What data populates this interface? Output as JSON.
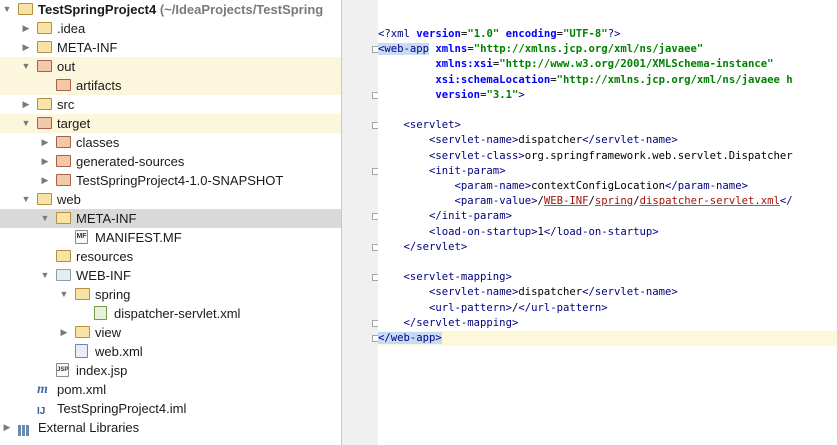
{
  "project_tree": [
    {
      "label": "TestSpringProject4",
      "suffix": "(~/IdeaProjects/TestSpring",
      "depth": 0,
      "expanded": true,
      "icon": "folder",
      "bold": true,
      "highlight": "none"
    },
    {
      "label": ".idea",
      "depth": 1,
      "expanded": false,
      "icon": "folder",
      "highlight": "none"
    },
    {
      "label": "META-INF",
      "depth": 1,
      "expanded": false,
      "icon": "folder",
      "highlight": "none"
    },
    {
      "label": "out",
      "depth": 1,
      "expanded": true,
      "icon": "folder-red",
      "highlight": "yellow"
    },
    {
      "label": "artifacts",
      "depth": 2,
      "expanded": null,
      "icon": "folder-red",
      "highlight": "yellow"
    },
    {
      "label": "src",
      "depth": 1,
      "expanded": false,
      "icon": "folder",
      "highlight": "none"
    },
    {
      "label": "target",
      "depth": 1,
      "expanded": true,
      "icon": "folder-red",
      "highlight": "yellow"
    },
    {
      "label": "classes",
      "depth": 2,
      "expanded": false,
      "icon": "folder-red",
      "highlight": "none"
    },
    {
      "label": "generated-sources",
      "depth": 2,
      "expanded": false,
      "icon": "folder-red",
      "highlight": "none"
    },
    {
      "label": "TestSpringProject4-1.0-SNAPSHOT",
      "depth": 2,
      "expanded": false,
      "icon": "folder-red",
      "highlight": "none"
    },
    {
      "label": "web",
      "depth": 1,
      "expanded": true,
      "icon": "folder",
      "highlight": "none"
    },
    {
      "label": "META-INF",
      "depth": 2,
      "expanded": true,
      "icon": "folder",
      "highlight": "gray"
    },
    {
      "label": "MANIFEST.MF",
      "depth": 3,
      "expanded": null,
      "icon": "file-mf",
      "highlight": "none"
    },
    {
      "label": "resources",
      "depth": 2,
      "expanded": null,
      "icon": "folder",
      "highlight": "none"
    },
    {
      "label": "WEB-INF",
      "depth": 2,
      "expanded": true,
      "icon": "folder-web",
      "highlight": "none"
    },
    {
      "label": "spring",
      "depth": 3,
      "expanded": true,
      "icon": "folder",
      "highlight": "none"
    },
    {
      "label": "dispatcher-servlet.xml",
      "depth": 4,
      "expanded": null,
      "icon": "file-spring-xml",
      "highlight": "none"
    },
    {
      "label": "view",
      "depth": 3,
      "expanded": false,
      "icon": "folder",
      "highlight": "none"
    },
    {
      "label": "web.xml",
      "depth": 3,
      "expanded": null,
      "icon": "file-web-xml",
      "highlight": "none"
    },
    {
      "label": "index.jsp",
      "depth": 2,
      "expanded": null,
      "icon": "file-jsp",
      "highlight": "none"
    },
    {
      "label": "pom.xml",
      "depth": 1,
      "expanded": null,
      "icon": "file-maven",
      "highlight": "none"
    },
    {
      "label": "TestSpringProject4.iml",
      "depth": 1,
      "expanded": null,
      "icon": "file-iml",
      "highlight": "none"
    },
    {
      "label": "External Libraries",
      "depth": 0,
      "expanded": false,
      "icon": "libraries",
      "highlight": "none"
    }
  ],
  "badges": {
    "mf": "MF",
    "jsp": "JSP",
    "iml": "IJ",
    "maven": "m"
  },
  "code_lines": [
    [
      {
        "t": "decl",
        "s": "<?xml "
      },
      {
        "t": "attr",
        "s": "version"
      },
      {
        "t": "txt",
        "s": "="
      },
      {
        "t": "val",
        "s": "\"1.0\""
      },
      {
        "t": "txt",
        "s": " "
      },
      {
        "t": "attr",
        "s": "encoding"
      },
      {
        "t": "txt",
        "s": "="
      },
      {
        "t": "val",
        "s": "\"UTF-8\""
      },
      {
        "t": "decl",
        "s": "?>"
      }
    ],
    [
      {
        "t": "sel",
        "s": "<web-app"
      },
      {
        "t": "txt",
        "s": " "
      },
      {
        "t": "attr",
        "s": "xmlns"
      },
      {
        "t": "txt",
        "s": "="
      },
      {
        "t": "val",
        "s": "\"http://xmlns.jcp.org/xml/ns/javaee\""
      }
    ],
    [
      {
        "t": "txt",
        "s": "         "
      },
      {
        "t": "attr",
        "s": "xmlns:xsi"
      },
      {
        "t": "txt",
        "s": "="
      },
      {
        "t": "val",
        "s": "\"http://www.w3.org/2001/XMLSchema-instance\""
      }
    ],
    [
      {
        "t": "txt",
        "s": "         "
      },
      {
        "t": "attr",
        "s": "xsi:schemaLocation"
      },
      {
        "t": "txt",
        "s": "="
      },
      {
        "t": "val",
        "s": "\"http://xmlns.jcp.org/xml/ns/javaee h"
      }
    ],
    [
      {
        "t": "txt",
        "s": "         "
      },
      {
        "t": "attr",
        "s": "version"
      },
      {
        "t": "txt",
        "s": "="
      },
      {
        "t": "val",
        "s": "\"3.1\""
      },
      {
        "t": "tag",
        "s": ">"
      }
    ],
    [],
    [
      {
        "t": "txt",
        "s": "    "
      },
      {
        "t": "tag",
        "s": "<servlet>"
      }
    ],
    [
      {
        "t": "txt",
        "s": "        "
      },
      {
        "t": "tag",
        "s": "<servlet-name>"
      },
      {
        "t": "txt",
        "s": "dispatcher"
      },
      {
        "t": "tag",
        "s": "</servlet-name>"
      }
    ],
    [
      {
        "t": "txt",
        "s": "        "
      },
      {
        "t": "tag",
        "s": "<servlet-class>"
      },
      {
        "t": "txt",
        "s": "org.springframework.web.servlet.Dispatcher"
      }
    ],
    [
      {
        "t": "txt",
        "s": "        "
      },
      {
        "t": "tag",
        "s": "<init-param>"
      }
    ],
    [
      {
        "t": "txt",
        "s": "            "
      },
      {
        "t": "tag",
        "s": "<param-name>"
      },
      {
        "t": "txt",
        "s": "contextConfigLocation"
      },
      {
        "t": "tag",
        "s": "</param-name>"
      }
    ],
    [
      {
        "t": "txt",
        "s": "            "
      },
      {
        "t": "tag",
        "s": "<param-value>"
      },
      {
        "t": "txt",
        "s": "/"
      },
      {
        "t": "link",
        "s": "WEB-INF"
      },
      {
        "t": "txt",
        "s": "/"
      },
      {
        "t": "link",
        "s": "spring"
      },
      {
        "t": "txt",
        "s": "/"
      },
      {
        "t": "link",
        "s": "dispatcher-servlet.xml"
      },
      {
        "t": "tag",
        "s": "</"
      }
    ],
    [
      {
        "t": "txt",
        "s": "        "
      },
      {
        "t": "tag",
        "s": "</init-param>"
      }
    ],
    [
      {
        "t": "txt",
        "s": "        "
      },
      {
        "t": "tag",
        "s": "<load-on-startup>"
      },
      {
        "t": "txt",
        "s": "1"
      },
      {
        "t": "tag",
        "s": "</load-on-startup>"
      }
    ],
    [
      {
        "t": "txt",
        "s": "    "
      },
      {
        "t": "tag",
        "s": "</servlet>"
      }
    ],
    [],
    [
      {
        "t": "txt",
        "s": "    "
      },
      {
        "t": "tag",
        "s": "<servlet-mapping>"
      }
    ],
    [
      {
        "t": "txt",
        "s": "        "
      },
      {
        "t": "tag",
        "s": "<servlet-name>"
      },
      {
        "t": "txt",
        "s": "dispatcher"
      },
      {
        "t": "tag",
        "s": "</servlet-name>"
      }
    ],
    [
      {
        "t": "txt",
        "s": "        "
      },
      {
        "t": "tag",
        "s": "<url-pattern>"
      },
      {
        "t": "txt",
        "s": "/"
      },
      {
        "t": "tag",
        "s": "</url-pattern>"
      }
    ],
    [
      {
        "t": "txt",
        "s": "    "
      },
      {
        "t": "tag",
        "s": "</servlet-mapping>"
      }
    ],
    [
      {
        "t": "sel",
        "s": "</web-app>"
      }
    ]
  ]
}
